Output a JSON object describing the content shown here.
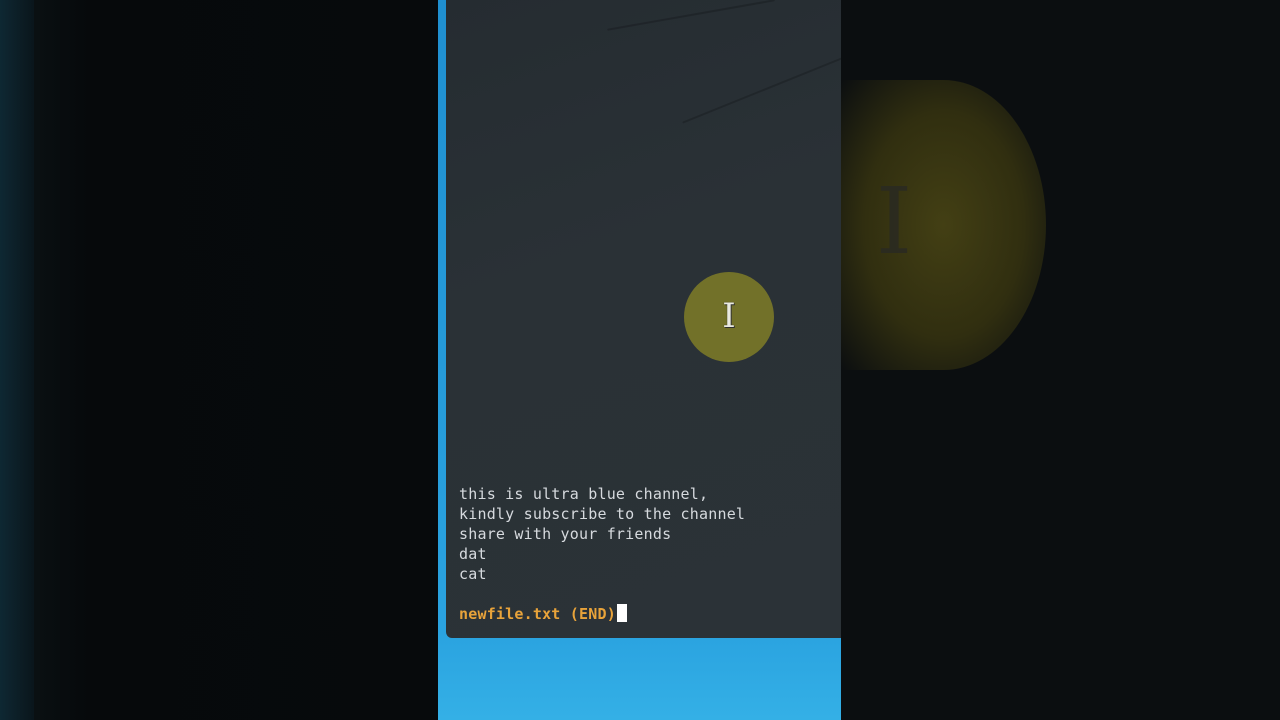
{
  "pager": {
    "lines": [
      "this is ultra blue channel,",
      "kindly subscribe to the channel",
      "share with your friends",
      "dat",
      "cat"
    ],
    "status": "newfile.txt (END)"
  },
  "pointer": {
    "type": "i-beam-cursor-icon"
  },
  "colors": {
    "terminal_bg": "#2a3136",
    "text": "#d6dade",
    "status": "#e8a33a",
    "desktop_blue": "#2aa3e0",
    "pointer_halo": "#78762a"
  }
}
